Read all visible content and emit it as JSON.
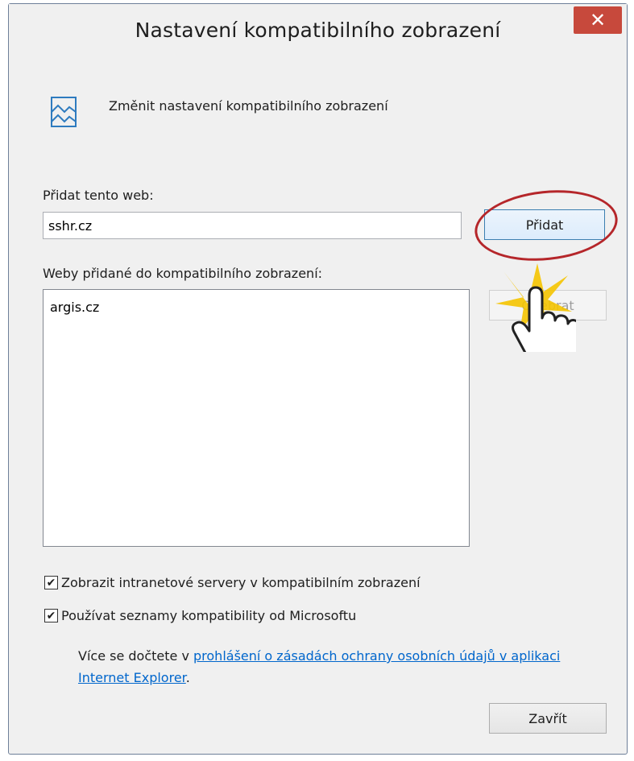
{
  "window": {
    "title": "Nastavení kompatibilního zobrazení",
    "close_glyph": "✕"
  },
  "header": {
    "text": "Změnit nastavení kompatibilního zobrazení",
    "icon": "compatibility-view-icon"
  },
  "add_site": {
    "label": "Přidat tento web:",
    "value": "sshr.cz",
    "button_label": "Přidat"
  },
  "added_sites": {
    "label": "Weby přidané do kompatibilního zobrazení:",
    "items": [
      "argis.cz"
    ],
    "remove_button_label": "Odebrat"
  },
  "options": {
    "intranet_label": "Zobrazit intranetové servery v kompatibilním zobrazení",
    "intranet_checked": true,
    "microsoft_list_label": "Používat seznamy kompatibility od Microsoftu",
    "microsoft_list_checked": true
  },
  "info": {
    "prefix": "Více se dočtete v ",
    "link": "prohlášení o zásadách ochrany osobních údajů v aplikaci Internet Explorer",
    "suffix": "."
  },
  "footer": {
    "close_button_label": "Zavřít"
  },
  "colors": {
    "close_button": "#c7493c",
    "highlight": "#b5262a",
    "link": "#0066cc"
  }
}
